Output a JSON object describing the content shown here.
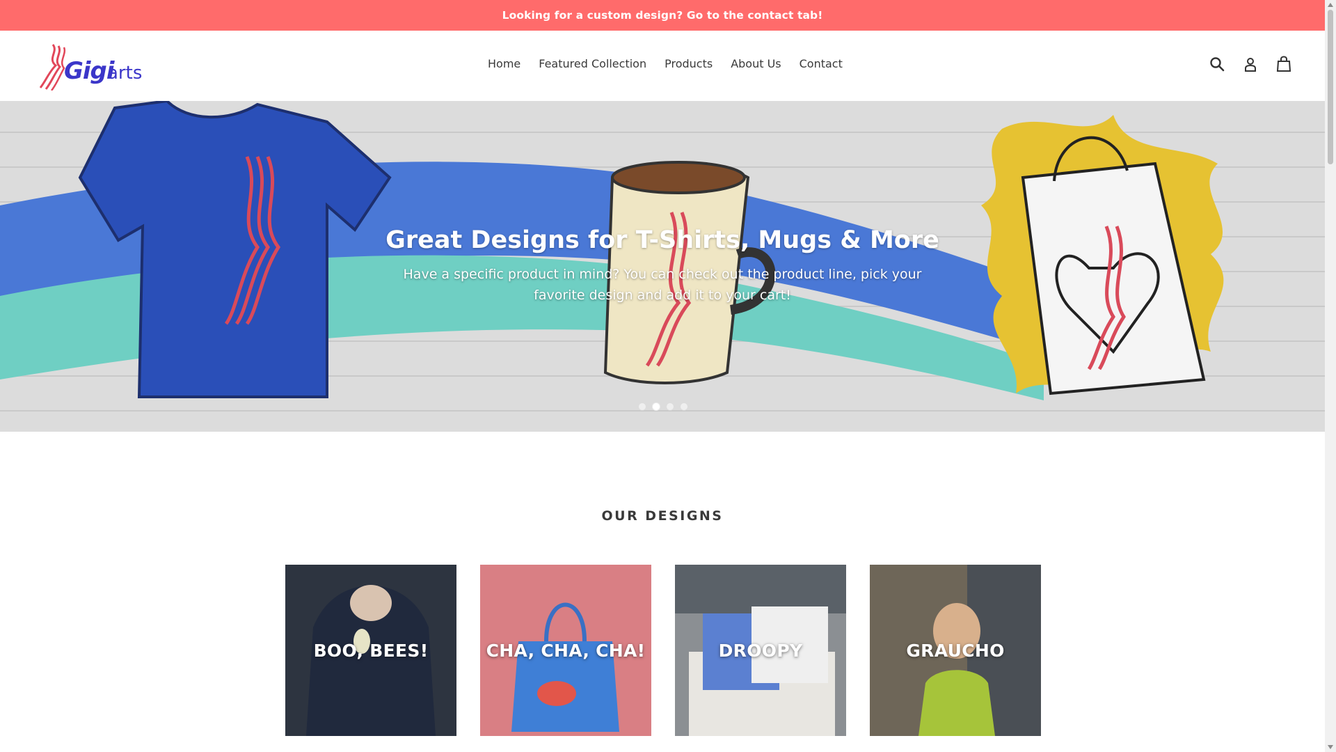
{
  "announcement": {
    "text": "Looking for a custom design? Go to the contact tab!"
  },
  "brand": {
    "logo_text": "Gigi",
    "logo_suffix": "arts",
    "accent": "#3b36c9",
    "stripe": "#e2475a"
  },
  "nav": {
    "items": [
      {
        "label": "Home"
      },
      {
        "label": "Featured Collection"
      },
      {
        "label": "Products"
      },
      {
        "label": "About Us"
      },
      {
        "label": "Contact"
      }
    ]
  },
  "header_icons": [
    "search-icon",
    "account-icon",
    "cart-icon"
  ],
  "hero": {
    "title": "Great Designs for T-Shirts, Mugs & More",
    "subtitle": "Have a specific product in mind? You can check out the product line, pick your favorite design and add it to your cart!",
    "slides": 4,
    "active_slide": 2
  },
  "designs": {
    "heading": "OUR DESIGNS",
    "items": [
      {
        "label": "BOO, BEES!"
      },
      {
        "label": "CHA, CHA, CHA!"
      },
      {
        "label": "DROOPY"
      },
      {
        "label": "GRAUCHO"
      }
    ]
  },
  "colors": {
    "announcement_bg": "#ff6b6b",
    "text": "#3a3a3a"
  }
}
